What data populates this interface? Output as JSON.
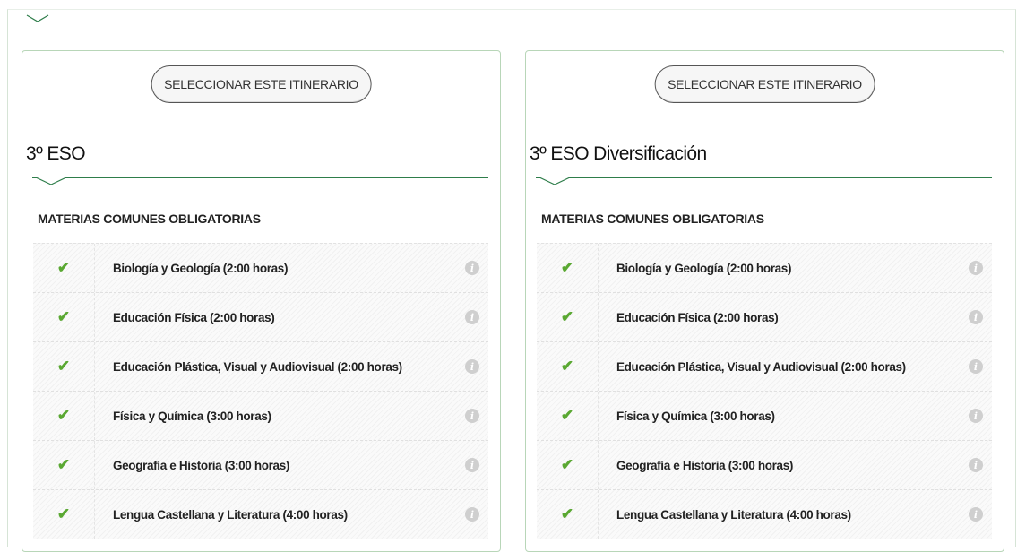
{
  "panels": [
    {
      "button_label": "SELECCIONAR ESTE ITINERARIO",
      "title": "3º ESO",
      "section": "MATERIAS COMUNES OBLIGATORIAS",
      "subjects": [
        "Biología y Geología (2:00 horas)",
        "Educación Física (2:00 horas)",
        "Educación Plástica, Visual y Audiovisual (2:00 horas)",
        "Física y Química (3:00 horas)",
        "Geografía e Historia (3:00 horas)",
        "Lengua Castellana y Literatura (4:00 horas)"
      ]
    },
    {
      "button_label": "SELECCIONAR ESTE ITINERARIO",
      "title": "3º ESO Diversificación",
      "section": "MATERIAS COMUNES OBLIGATORIAS",
      "subjects": [
        "Biología y Geología (2:00 horas)",
        "Educación Física (2:00 horas)",
        "Educación Plástica, Visual y Audiovisual (2:00 horas)",
        "Física y Química (3:00 horas)",
        "Geografía e Historia (3:00 horas)",
        "Lengua Castellana y Literatura (4:00 horas)"
      ]
    }
  ],
  "icons": {
    "check": "checkmark-icon",
    "info": "info-icon",
    "chevron": "chevron-down-icon"
  },
  "colors": {
    "accent_green": "#2e7d4a",
    "check_green": "#5aa832",
    "info_gray": "#cfcfcf"
  }
}
